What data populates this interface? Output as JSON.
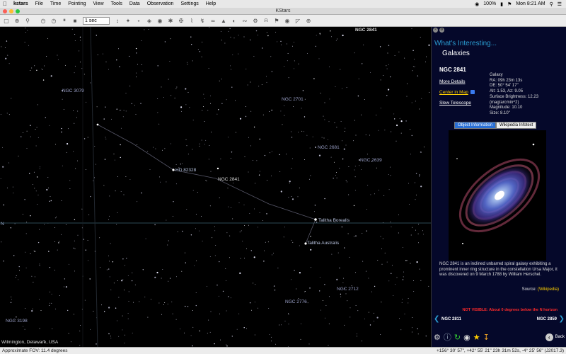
{
  "menubar": {
    "apple": "",
    "items": [
      "kstars",
      "File",
      "Time",
      "Pointing",
      "View",
      "Tools",
      "Data",
      "Observation",
      "Settings",
      "Help"
    ],
    "battery": "100%",
    "clock": "Mon 8:21 AM"
  },
  "window": {
    "title": "KStars"
  },
  "toolbar": {
    "time_step": "1 sec"
  },
  "sky": {
    "horizon_label": "N",
    "labels": [
      {
        "text": "NGC 3079",
        "kind": "ngc"
      },
      {
        "text": "NGC 2701",
        "kind": "ngc"
      },
      {
        "text": "NGC 2681",
        "kind": "ngc"
      },
      {
        "text": "NGC 2639",
        "kind": "ngc"
      },
      {
        "text": "HD 82328",
        "kind": "star"
      },
      {
        "text": "NGC 2841",
        "kind": "white"
      },
      {
        "text": "Talitha Borealis",
        "kind": "star"
      },
      {
        "text": "Talitha Australis",
        "kind": "star"
      },
      {
        "text": "NGC 2712",
        "kind": "ngc"
      },
      {
        "text": "NGC 2776",
        "kind": "ngc"
      },
      {
        "text": "NGC 3198",
        "kind": "ngc"
      },
      {
        "text": "NGC 2841",
        "kind": "white"
      }
    ],
    "location": "Wilmington, Delaware, USA"
  },
  "status": {
    "fov": "Approximate FOV: 11.4 degrees",
    "coords": "+156° 30' 57\", +42° 55' 21\"  23h 31m 52s,  -4° 25' 56\" (J2017.3)"
  },
  "panel": {
    "title": "What's Interesting...",
    "category": "Galaxies",
    "object_name": "NGC 2841",
    "links": {
      "more_details": "More Details",
      "center_in_map": "Center in Map",
      "slew_telescope": "Slew Telescope"
    },
    "details": [
      "Galaxy",
      "RA: 09h 23m 13s",
      "DE: 50° 54' 17\"",
      "Alt: 1.53, Az: 9.05",
      "Surface Brightness: 12.23",
      "(mag/arcmin^2)",
      "Magnitude: 10.10",
      "Size: 8.10\""
    ],
    "tabs": [
      "Object Information",
      "Wikipedia Infotext"
    ],
    "description": "NGC 2841 is an inclined unbarred spiral galaxy exhibiting a prominent inner ring structure in the constellation Ursa Major, it was discovered on 9 March 1788 by William Herschel.",
    "source_label": "Source:",
    "source_link": "(Wikipedia)",
    "not_visible": "NOT VISIBLE: About 0 degrees below the N horizon",
    "nav_prev": "NGC 2811",
    "nav_next": "NGC 2859",
    "back_label": "Back"
  },
  "colors": {
    "panel_bg": "#05082a",
    "accent": "#2a9bd0",
    "link_yellow": "#ffd000",
    "warning_red": "#ff2a2a"
  }
}
